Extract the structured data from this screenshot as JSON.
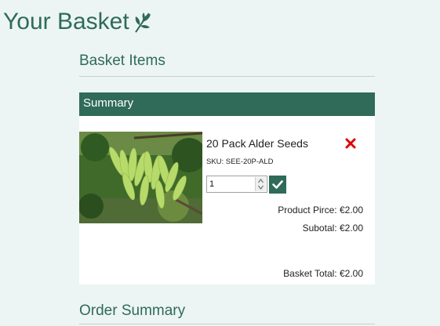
{
  "page": {
    "title": "Your Basket",
    "title_icon": "leaf-icon"
  },
  "sections": {
    "basket_items": "Basket Items",
    "order_summary": "Order Summary"
  },
  "summary": {
    "header": "Summary",
    "item": {
      "name": "20 Pack Alder Seeds",
      "sku": "SKU: SEE-20P-ALD",
      "image_subject": "green alder seed pods on a branch",
      "quantity": "1",
      "remove_icon": "close-icon",
      "confirm_icon": "check-icon",
      "product_price_label": "Product Pirce:",
      "product_price": "€2.00",
      "subtotal_label": "Subotal:",
      "subtotal": "€2.00"
    },
    "basket_total_label": "Basket Total:",
    "basket_total": "€2.00"
  },
  "colors": {
    "brand_green": "#2f6b58",
    "background": "#ecf5f4",
    "remove_red": "#e00000"
  }
}
